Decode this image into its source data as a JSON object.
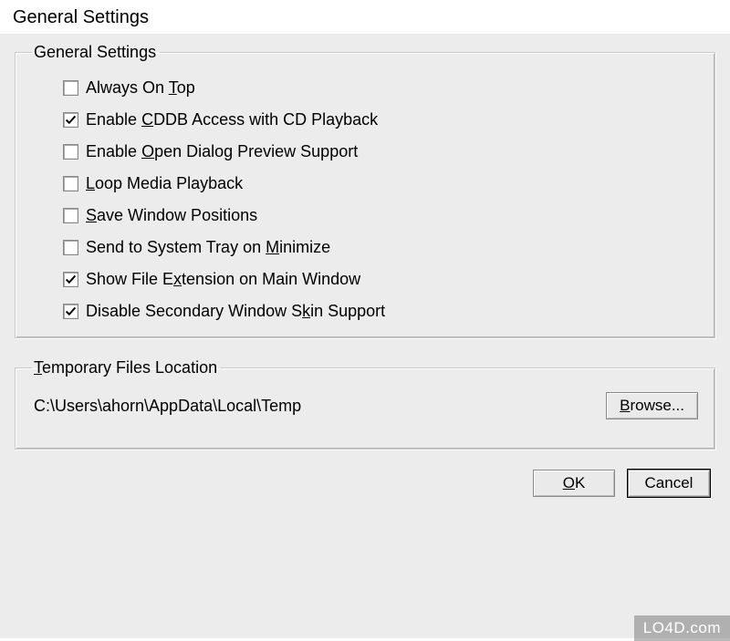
{
  "window": {
    "title": "General Settings"
  },
  "group1": {
    "legend": "General Settings",
    "items": [
      {
        "checked": false,
        "pre": "Always On ",
        "accel": "T",
        "post": "op"
      },
      {
        "checked": true,
        "pre": "Enable ",
        "accel": "C",
        "post": "DDB Access with CD Playback"
      },
      {
        "checked": false,
        "pre": "Enable ",
        "accel": "O",
        "post": "pen Dialog Preview Support"
      },
      {
        "checked": false,
        "pre": "",
        "accel": "L",
        "post": "oop Media Playback"
      },
      {
        "checked": false,
        "pre": "",
        "accel": "S",
        "post": "ave Window Positions"
      },
      {
        "checked": false,
        "pre": "Send to System Tray on ",
        "accel": "M",
        "post": "inimize"
      },
      {
        "checked": true,
        "pre": "Show File E",
        "accel": "x",
        "post": "tension on Main Window"
      },
      {
        "checked": true,
        "pre": "Disable Secondary Window S",
        "accel": "k",
        "post": "in Support"
      }
    ]
  },
  "group2": {
    "legend_pre": "",
    "legend_accel": "T",
    "legend_post": "emporary Files Location",
    "path": "C:\\Users\\ahorn\\AppData\\Local\\Temp",
    "browse_pre": "",
    "browse_accel": "B",
    "browse_post": "rowse..."
  },
  "buttons": {
    "ok_pre": "",
    "ok_accel": "O",
    "ok_post": "K",
    "cancel": "Cancel"
  },
  "watermark": "LO4D.com"
}
